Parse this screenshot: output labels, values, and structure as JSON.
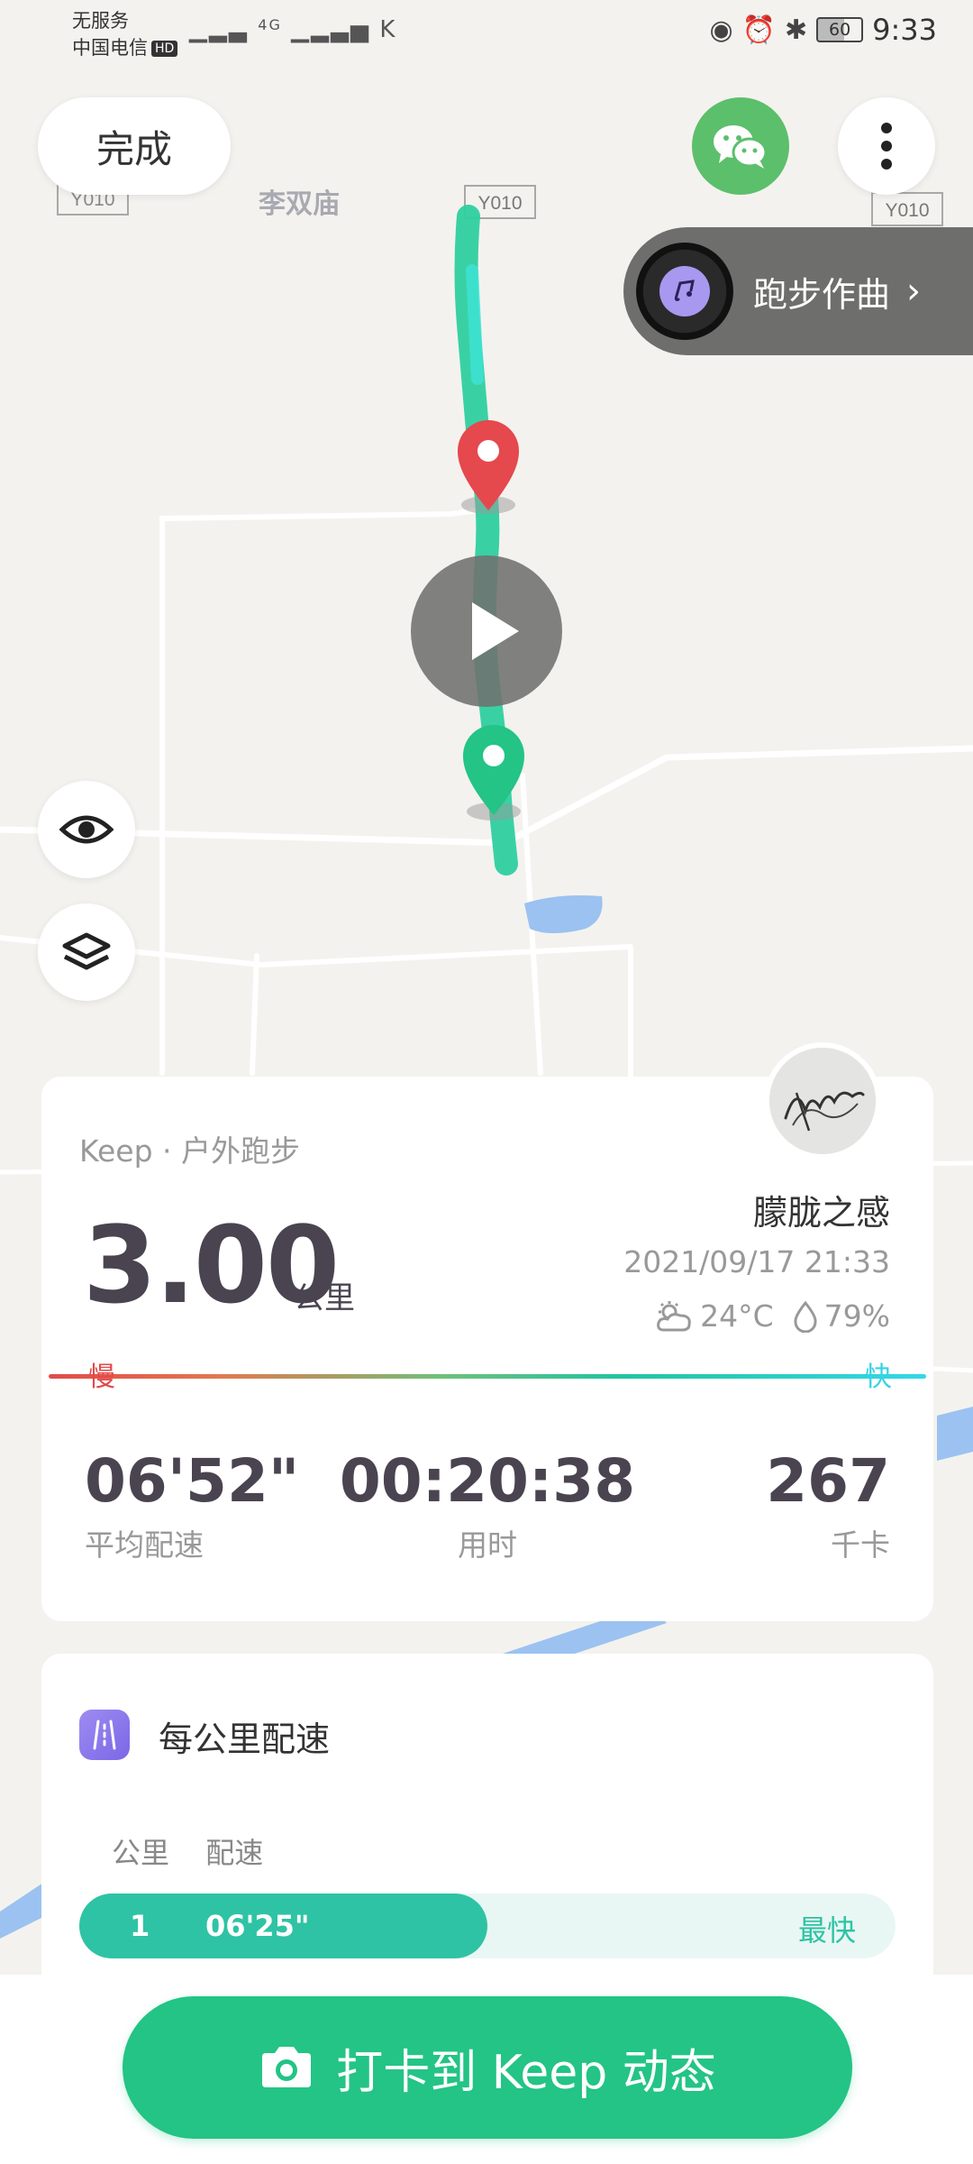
{
  "status_bar": {
    "line1": "无服务",
    "line2": "中国电信",
    "hd": "HD",
    "network": "4G",
    "battery": "60",
    "time": "9:33"
  },
  "map": {
    "road_labels": [
      "Y010",
      "Y010",
      "Y010"
    ],
    "place_label": "李双庙"
  },
  "top": {
    "done_label": "完成"
  },
  "music": {
    "label": "跑步作曲",
    "chevron": "›"
  },
  "summary": {
    "source": "Keep · 户外跑步",
    "distance": "3.00",
    "distance_unit": "公里",
    "user_name": "朦胧之感",
    "date": "2021/09/17 21:33",
    "temperature": "24°C",
    "humidity": "79%",
    "slow_label": "慢",
    "fast_label": "快",
    "metrics": [
      {
        "value": "06'52\"",
        "label": "平均配速"
      },
      {
        "value": "00:20:38",
        "label": "用时"
      },
      {
        "value": "267",
        "label": "千卡"
      }
    ]
  },
  "pace_card": {
    "title": "每公里配速",
    "columns": [
      "公里",
      "配速"
    ],
    "rows": [
      {
        "km": "1",
        "pace": "06'25\"",
        "tag": "最快",
        "fill": 0.5
      }
    ]
  },
  "cta": {
    "label": "打卡到 Keep 动态"
  },
  "colors": {
    "route": "#2ecf9f",
    "start_pin": "#23c485",
    "end_pin": "#e5484d",
    "cta": "#23c485",
    "wechat": "#5cbf6b"
  }
}
